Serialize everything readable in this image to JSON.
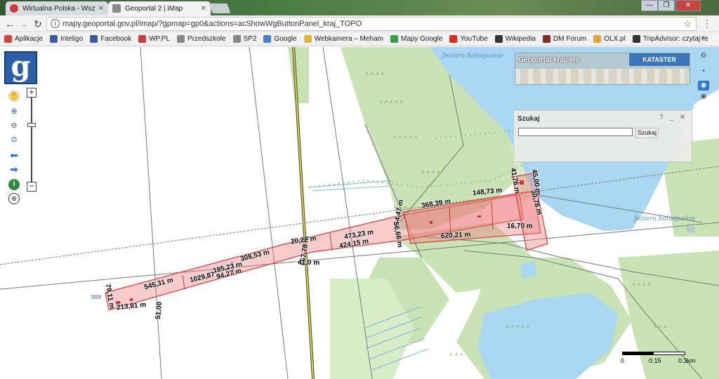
{
  "browser": {
    "tabs": [
      {
        "label": "Wirtualna Polska - Wszy",
        "active": false
      },
      {
        "label": "Geoportal 2 | iMap",
        "active": true
      }
    ],
    "window_controls": [
      "—",
      "❐",
      "✕"
    ],
    "url": "mapy.geoportal.gov.pl/imap/?gpmap=gp0&actions=acShowWgButtonPanel_kraj_TOPO",
    "bookmarks": [
      {
        "label": "Aplikacje",
        "icon": "apps-grid-icon",
        "color": "#d0473b"
      },
      {
        "label": "Inteligo",
        "icon": "inteligo-icon",
        "color": "#3a5da8"
      },
      {
        "label": "Facebook",
        "icon": "facebook-icon",
        "color": "#3b5998"
      },
      {
        "label": "WP.PL",
        "icon": "wp-icon",
        "color": "#d23b3b"
      },
      {
        "label": "Przedszkole",
        "icon": "page-icon",
        "color": "#888888"
      },
      {
        "label": "SP2",
        "icon": "page-icon",
        "color": "#888888"
      },
      {
        "label": "Google",
        "icon": "google-icon",
        "color": "#4a7fd6"
      },
      {
        "label": "Webkamera – Meham",
        "icon": "webcam-icon",
        "color": "#e0b62c"
      },
      {
        "label": "Mapy Google",
        "icon": "maps-icon",
        "color": "#3a9d4a"
      },
      {
        "label": "YouTube",
        "icon": "youtube-icon",
        "color": "#e02b20"
      },
      {
        "label": "Wikipedia",
        "icon": "wikipedia-icon",
        "color": "#333333"
      },
      {
        "label": "DM Forum",
        "icon": "forum-icon",
        "color": "#8a2a2a"
      },
      {
        "label": "OLX.pl",
        "icon": "olx-icon",
        "color": "#e8a23a"
      },
      {
        "label": "TripAdvisor: czytaj re",
        "icon": "tripadvisor-icon",
        "color": "#333333"
      }
    ],
    "bookmarks_more": "»"
  },
  "map": {
    "logo_letter": "g",
    "overview": {
      "title": "Geoportal krajowy",
      "button": "KATASTER"
    },
    "search": {
      "title": "Szukaj",
      "controls": "? _ ✕",
      "button": "Szukaj",
      "input_value": ""
    },
    "scale": {
      "labels": [
        "0",
        "0.15",
        "0.3km"
      ]
    },
    "lake_labels": [
      "Jezioro Sobiejuskie",
      "Jezioro Sobiejuskie"
    ],
    "measurements": [
      "368,39 m",
      "148,73 m",
      "473,23 m",
      "424,15 m",
      "620,21 m",
      "308,53 m",
      "185,23 m",
      "1029,87",
      "94,27 m",
      "545,31 m",
      "213,81 m",
      "51,00",
      "16,70 m",
      "54,47 m",
      "56,66 m",
      "20,27 m",
      "457,78 m",
      "41,0 m",
      "30,78 m",
      "41,76 m",
      "45,00 m",
      "79,11 m"
    ]
  }
}
